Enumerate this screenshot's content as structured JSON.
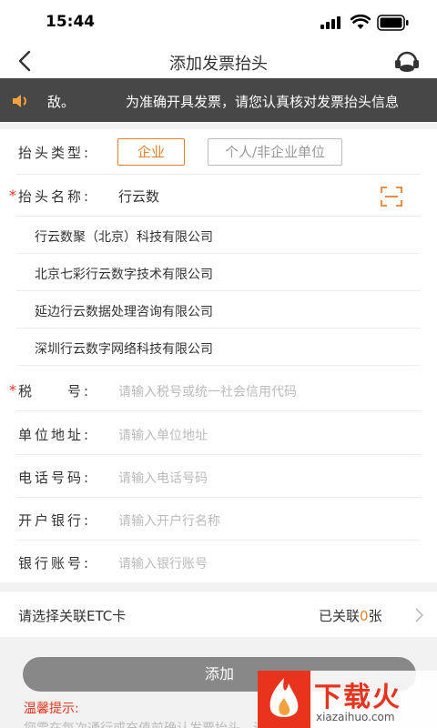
{
  "status": {
    "time": "15:44"
  },
  "nav": {
    "title": "添加发票抬头"
  },
  "notice": {
    "text_prefix": "敌。",
    "text": "为准确开具发票，请您认真核对发票抬头信息"
  },
  "form": {
    "type": {
      "label": "抬头类型:",
      "option_company": "企业",
      "option_personal": "个人/非企业单位",
      "selected": "企业"
    },
    "name": {
      "label": "抬头名称:",
      "required_mark": "*",
      "value": "行云数"
    },
    "suggestions": [
      "行云数聚（北京）科技有限公司",
      "北京七彩行云数字技术有限公司",
      "延边行云数据处理咨询有限公司",
      "深圳行云数字网络科技有限公司"
    ],
    "tax": {
      "label": "税　　号:",
      "required_mark": "*",
      "placeholder": "请输入税号或统一社会信用代码"
    },
    "address": {
      "label": "单位地址:",
      "placeholder": "请输入单位地址"
    },
    "phone": {
      "label": "电话号码:",
      "placeholder": "请输入电话号码"
    },
    "bank": {
      "label": "开户银行:",
      "placeholder": "请输入开户行名称"
    },
    "account": {
      "label": "银行账号:",
      "placeholder": "请输入银行账号"
    }
  },
  "etc": {
    "label": "请选择关联ETC卡",
    "linked_prefix": "已关联",
    "count": "0",
    "unit": "张"
  },
  "add_button": "添加",
  "tips": {
    "title": "温馨提示:",
    "text": "您需在每次通行或充值前确认发票抬头，请仔细核对"
  },
  "watermark": {
    "name": "下载火",
    "domain": "xiazaihuo.com"
  },
  "colors": {
    "accent": "#e8802a",
    "required": "#e8341c",
    "notice_bg": "#474747"
  }
}
